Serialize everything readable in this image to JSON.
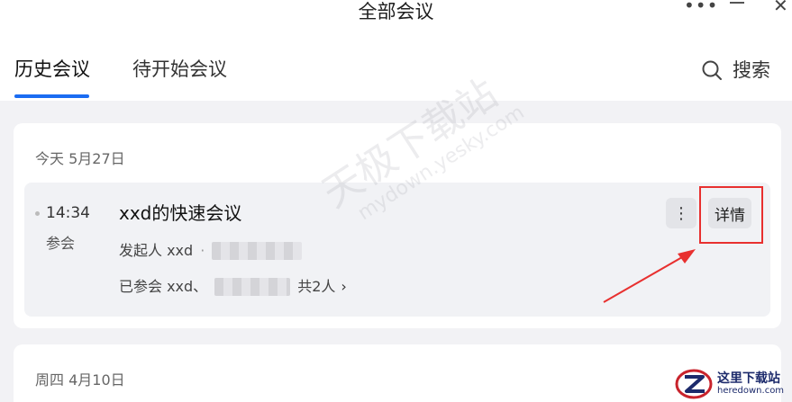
{
  "window": {
    "title": "全部会议",
    "more_glyph": "•••",
    "close_glyph": "✕"
  },
  "tabs": [
    {
      "label": "历史会议",
      "active": true
    },
    {
      "label": "待开始会议",
      "active": false
    }
  ],
  "search": {
    "label": "搜索",
    "icon": "search-icon"
  },
  "groups": [
    {
      "day_label": "今天 5月27日",
      "meetings": [
        {
          "time": "14:34",
          "status": "参会",
          "title": "xxd的快速会议",
          "host_prefix": "发起人 xxd",
          "host_sep": "·",
          "participants_prefix": "已参会 xxd、",
          "participants_count": "共2人",
          "chevron": "›",
          "more_glyph": "⋮",
          "detail_label": "详情"
        }
      ]
    },
    {
      "day_label": "周四 4月10日",
      "meetings": []
    }
  ],
  "overlay": {
    "watermark_main": "天极下载站",
    "watermark_sub": "mydown.yesky.com",
    "corner_logo_cn": "这里下载站",
    "corner_logo_en": "heredown.com",
    "highlight_color": "#e8302f"
  },
  "colors": {
    "accent": "#1a6cf2",
    "card_bg": "#ffffff",
    "page_bg": "#f2f2f5"
  }
}
